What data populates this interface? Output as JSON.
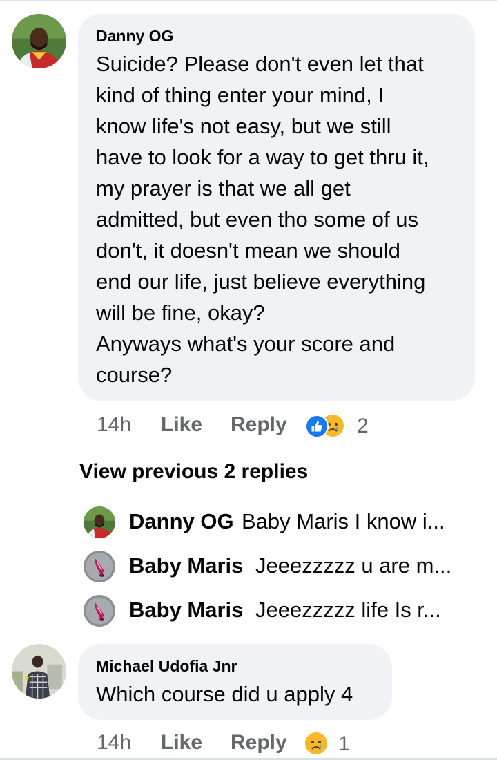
{
  "comments": [
    {
      "author": "Danny OG",
      "avatar_icon": "person-avatar-icon",
      "text": "Suicide? Please don't even let that\nkind of thing enter your mind, I\nknow life's not easy, but we still\nhave to look for a way to get thru it,\nmy prayer is that we all get\nadmitted, but even tho some of us\ndon't, it doesn't mean we should\nend our life, just believe everything\nwill be fine, okay?\nAnyways what's your score and\ncourse?",
      "time": "14h",
      "like_label": "Like",
      "reply_label": "Reply",
      "reactions": [
        "like-reaction-icon",
        "sad-reaction-icon"
      ],
      "reaction_count": "2"
    },
    {
      "author": "Michael Udofia Jnr",
      "avatar_icon": "person-avatar-icon",
      "text": "Which course did u apply 4",
      "time": "14h",
      "like_label": "Like",
      "reply_label": "Reply",
      "reactions": [
        "sad-reaction-icon"
      ],
      "reaction_count": "1"
    }
  ],
  "view_previous_label": "View previous 2 replies",
  "replies": [
    {
      "author": "Danny OG",
      "preview": "Baby Maris I know i..."
    },
    {
      "author": "Baby Maris",
      "preview": "Jeeezzzzz u are m..."
    },
    {
      "author": "Baby Maris",
      "preview": "Jeeezzzzz life Is r..."
    }
  ],
  "colors": {
    "bubble": "#f0f2f5",
    "meta_text": "#65676b",
    "like_blue": "#1877f2",
    "sad_yellow": "#f7b928"
  }
}
